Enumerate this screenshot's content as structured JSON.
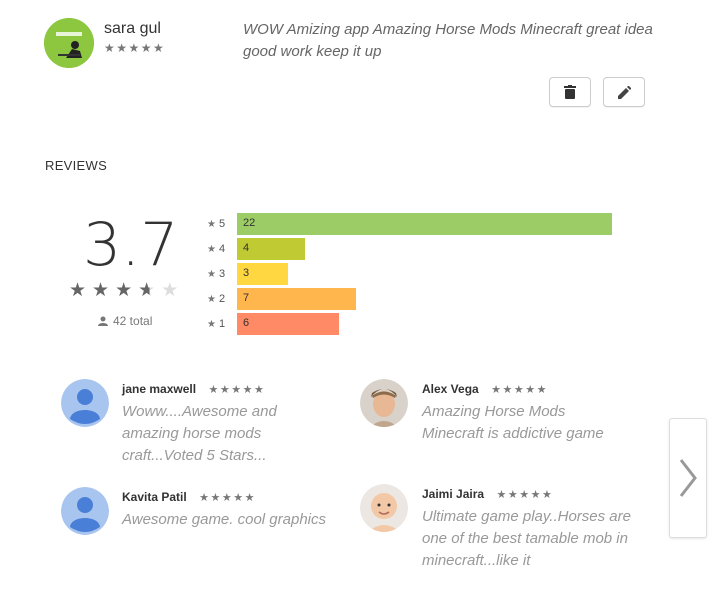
{
  "my_review": {
    "user_name": "sara gul",
    "stars": "★★★★★",
    "text": "WOW Amizing app Amazing Horse Mods Minecraft great idea good work keep it up",
    "delete_icon": "trash-icon",
    "edit_icon": "pencil-icon"
  },
  "reviews_heading": "REVIEWS",
  "summary": {
    "rating": "3.7",
    "rating_value": 3.7,
    "total": "42 total",
    "bars": [
      {
        "star": "5",
        "count": "22",
        "count_value": 22,
        "color": "#9ccc65"
      },
      {
        "star": "4",
        "count": "4",
        "count_value": 4,
        "color": "#c0ca33"
      },
      {
        "star": "3",
        "count": "3",
        "count_value": 3,
        "color": "#ffd740"
      },
      {
        "star": "2",
        "count": "7",
        "count_value": 7,
        "color": "#ffb74d"
      },
      {
        "star": "1",
        "count": "6",
        "count_value": 6,
        "color": "#ff8a65"
      }
    ]
  },
  "reviews": [
    {
      "name": "jane maxwell",
      "stars": "★★★★★",
      "text": "Woww....Awesome and amazing horse mods craft...Voted 5 Stars...",
      "avatar": "default-user-avatar"
    },
    {
      "name": "Alex Vega",
      "stars": "★★★★★",
      "text": "Amazing Horse Mods Minecraft is addictive game",
      "avatar": "photo-avatar"
    },
    {
      "name": "Kavita Patil",
      "stars": "★★★★★",
      "text": "Awesome game. cool graphics",
      "avatar": "default-user-avatar"
    },
    {
      "name": "Jaimi Jaira",
      "stars": "★★★★★",
      "text": "Ultimate game play..Horses are one of the best tamable mob in minecraft...like it",
      "avatar": "baby-photo-avatar"
    }
  ],
  "next_icon": "chevron-right-icon"
}
